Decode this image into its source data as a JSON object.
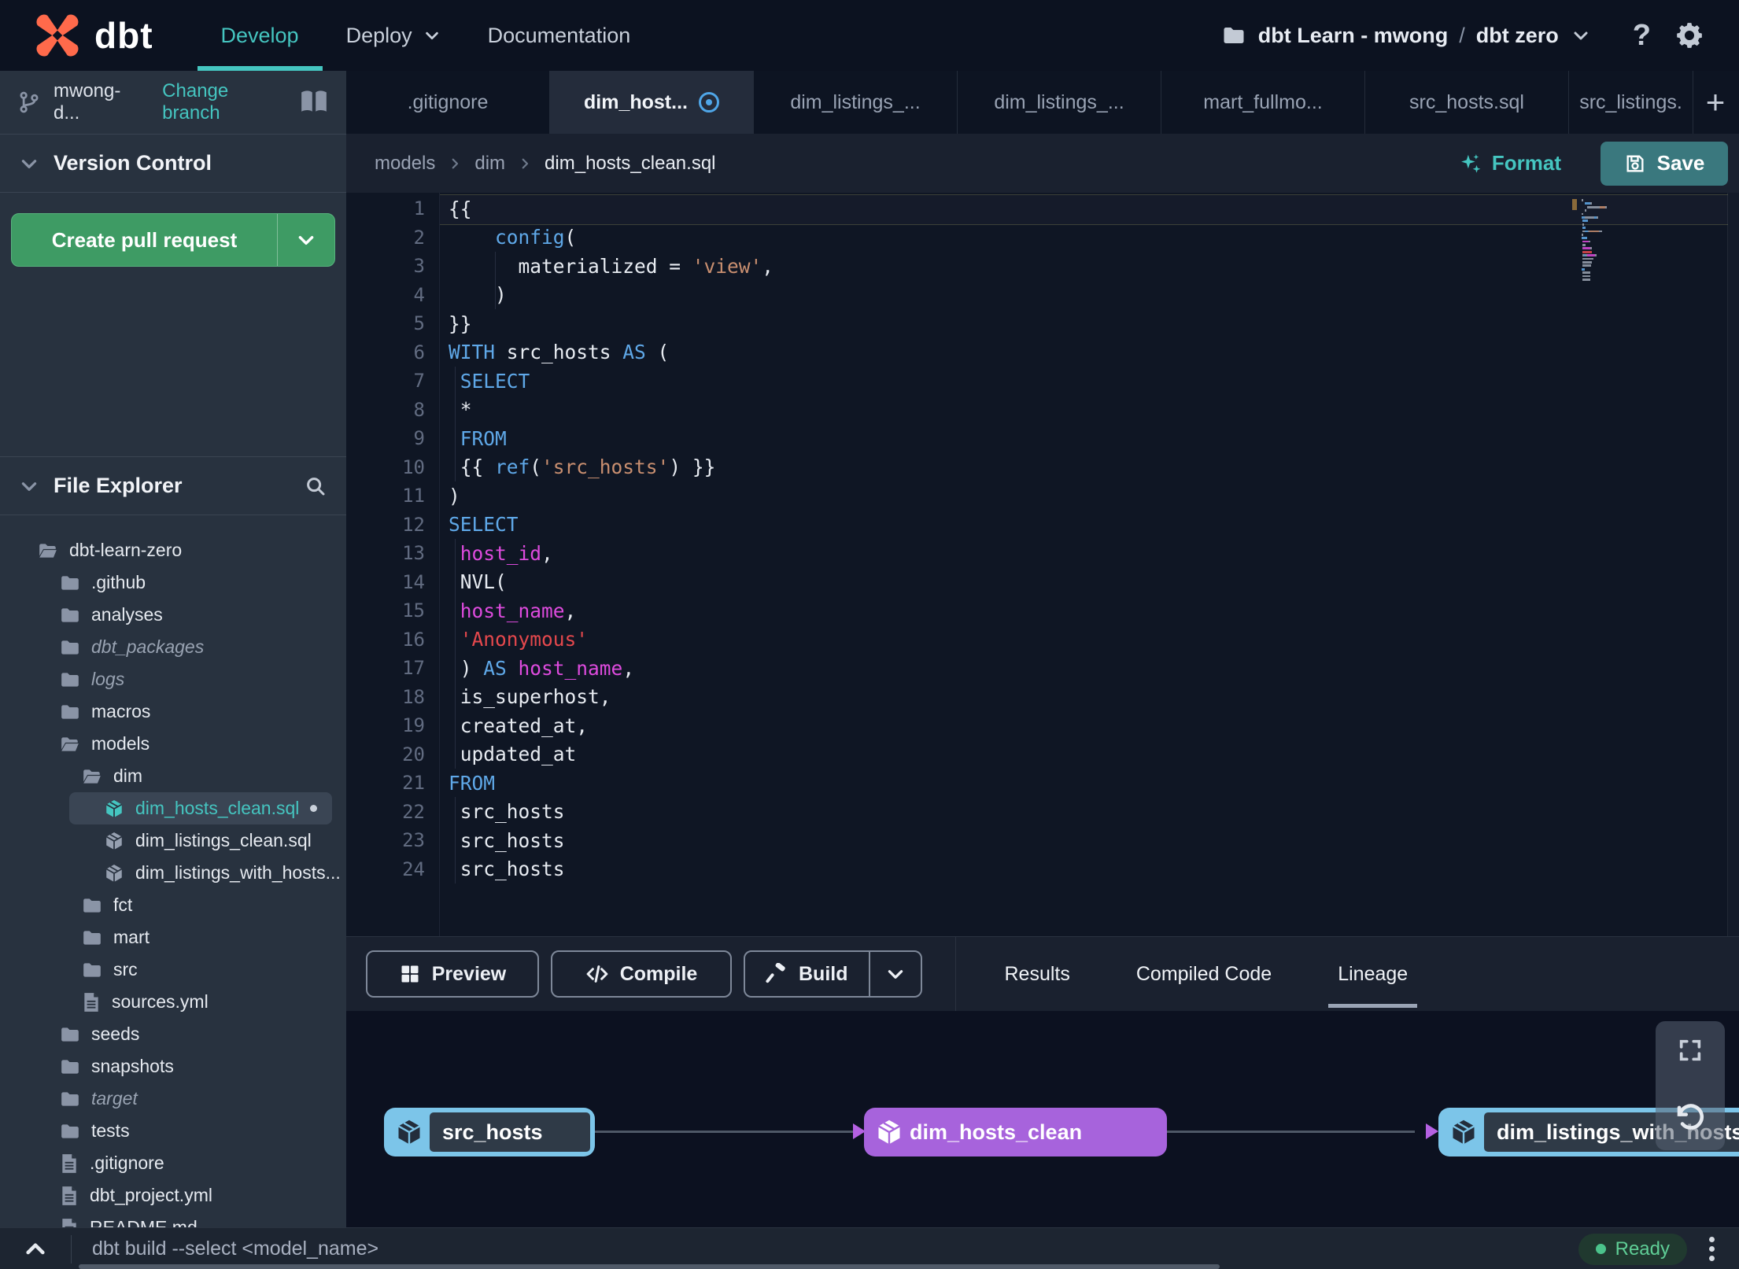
{
  "topnav": {
    "brand": "dbt",
    "nav": [
      {
        "label": "Develop",
        "active": true
      },
      {
        "label": "Deploy",
        "active": false,
        "chevron": true
      },
      {
        "label": "Documentation",
        "active": false
      }
    ],
    "project": {
      "account": "dbt Learn - mwong",
      "sep": "/",
      "name": "dbt zero"
    },
    "help_label": "?"
  },
  "sidebar": {
    "branch": {
      "name": "mwong-d...",
      "change_label": "Change branch"
    },
    "version_control": {
      "title": "Version Control",
      "button_label": "Create pull request"
    },
    "file_explorer": {
      "title": "File Explorer"
    },
    "tree": [
      {
        "label": "dbt-learn-zero",
        "type": "folder-open",
        "level": 0
      },
      {
        "label": ".github",
        "type": "folder",
        "level": 1
      },
      {
        "label": "analyses",
        "type": "folder",
        "level": 1
      },
      {
        "label": "dbt_packages",
        "type": "folder",
        "level": 1,
        "muted": true
      },
      {
        "label": "logs",
        "type": "folder",
        "level": 1,
        "muted": true
      },
      {
        "label": "macros",
        "type": "folder",
        "level": 1
      },
      {
        "label": "models",
        "type": "folder-open",
        "level": 1
      },
      {
        "label": "dim",
        "type": "folder-open",
        "level": 2
      },
      {
        "label": "dim_hosts_clean.sql",
        "type": "model",
        "level": 3,
        "selected": true,
        "modified": true
      },
      {
        "label": "dim_listings_clean.sql",
        "type": "model",
        "level": 3
      },
      {
        "label": "dim_listings_with_hosts...",
        "type": "model",
        "level": 3
      },
      {
        "label": "fct",
        "type": "folder",
        "level": 2
      },
      {
        "label": "mart",
        "type": "folder",
        "level": 2
      },
      {
        "label": "src",
        "type": "folder",
        "level": 2
      },
      {
        "label": "sources.yml",
        "type": "file",
        "level": 2
      },
      {
        "label": "seeds",
        "type": "folder",
        "level": 1
      },
      {
        "label": "snapshots",
        "type": "folder",
        "level": 1
      },
      {
        "label": "target",
        "type": "folder",
        "level": 1,
        "muted": true
      },
      {
        "label": "tests",
        "type": "folder",
        "level": 1
      },
      {
        "label": ".gitignore",
        "type": "file",
        "level": 1
      },
      {
        "label": "dbt_project.yml",
        "type": "file",
        "level": 1
      },
      {
        "label": "README.md",
        "type": "file",
        "level": 1
      }
    ]
  },
  "tabsbar": {
    "tabs": [
      {
        "label": ".gitignore",
        "active": false
      },
      {
        "label": "dim_host...",
        "active": true,
        "modified": true
      },
      {
        "label": "dim_listings_...",
        "active": false
      },
      {
        "label": "dim_listings_...",
        "active": false
      },
      {
        "label": "mart_fullmo...",
        "active": false
      },
      {
        "label": "src_hosts.sql",
        "active": false
      },
      {
        "label": "src_listings.",
        "active": false,
        "clipped": true
      }
    ],
    "add_label": "+"
  },
  "editor": {
    "breadcrumb": [
      "models",
      "dim",
      "dim_hosts_clean.sql"
    ],
    "format_label": "Format",
    "save_label": "Save",
    "palette": {
      "plain": "#E8ECF2",
      "kw": "#5FA8E8",
      "str": "#C98F70",
      "err": "#E5484D",
      "ident": "#DE4BDE"
    },
    "lines": [
      {
        "n": 1,
        "segs": [
          [
            "{{",
            "plain"
          ]
        ]
      },
      {
        "n": 2,
        "segs": [
          [
            "    ",
            "plain"
          ],
          [
            "config",
            "kw"
          ],
          [
            "(",
            "plain"
          ]
        ]
      },
      {
        "n": 3,
        "segs": [
          [
            "      materialized = ",
            "plain"
          ],
          [
            "'view'",
            "str"
          ],
          [
            ",",
            "plain"
          ]
        ]
      },
      {
        "n": 4,
        "segs": [
          [
            "    )",
            "plain"
          ]
        ]
      },
      {
        "n": 5,
        "segs": [
          [
            "}}",
            "plain"
          ]
        ]
      },
      {
        "n": 6,
        "segs": [
          [
            "WITH",
            "kw"
          ],
          [
            " src_hosts ",
            "plain"
          ],
          [
            "AS",
            "kw"
          ],
          [
            " (",
            "plain"
          ]
        ]
      },
      {
        "n": 7,
        "segs": [
          [
            " ",
            "plain"
          ],
          [
            "SELECT",
            "kw"
          ]
        ]
      },
      {
        "n": 8,
        "segs": [
          [
            " *",
            "plain"
          ]
        ]
      },
      {
        "n": 9,
        "segs": [
          [
            " ",
            "plain"
          ],
          [
            "FROM",
            "kw"
          ]
        ]
      },
      {
        "n": 10,
        "segs": [
          [
            " {{ ",
            "plain"
          ],
          [
            "ref",
            "kw"
          ],
          [
            "(",
            "plain"
          ],
          [
            "'src_hosts'",
            "str"
          ],
          [
            ") }}",
            "plain"
          ]
        ]
      },
      {
        "n": 11,
        "segs": [
          [
            ")",
            "plain"
          ]
        ]
      },
      {
        "n": 12,
        "segs": [
          [
            "SELECT",
            "kw"
          ]
        ]
      },
      {
        "n": 13,
        "segs": [
          [
            " ",
            "plain"
          ],
          [
            "host_id",
            "ident"
          ],
          [
            ",",
            "plain"
          ]
        ]
      },
      {
        "n": 14,
        "segs": [
          [
            " NVL(",
            "plain"
          ]
        ]
      },
      {
        "n": 15,
        "segs": [
          [
            " ",
            "plain"
          ],
          [
            "host_name",
            "ident"
          ],
          [
            ",",
            "plain"
          ]
        ]
      },
      {
        "n": 16,
        "segs": [
          [
            " ",
            "plain"
          ],
          [
            "'Anonymous'",
            "err"
          ]
        ]
      },
      {
        "n": 17,
        "segs": [
          [
            " ) ",
            "plain"
          ],
          [
            "AS",
            "kw"
          ],
          [
            " ",
            "plain"
          ],
          [
            "host_name",
            "ident"
          ],
          [
            ",",
            "plain"
          ]
        ]
      },
      {
        "n": 18,
        "segs": [
          [
            " is_superhost,",
            "plain"
          ]
        ]
      },
      {
        "n": 19,
        "segs": [
          [
            " created_at,",
            "plain"
          ]
        ]
      },
      {
        "n": 20,
        "segs": [
          [
            " updated_at",
            "plain"
          ]
        ]
      },
      {
        "n": 21,
        "segs": [
          [
            "FROM",
            "kw"
          ]
        ]
      },
      {
        "n": 22,
        "segs": [
          [
            " src_hosts",
            "plain"
          ]
        ]
      },
      {
        "n": 23,
        "segs": [
          [
            " src_hosts",
            "plain"
          ]
        ]
      },
      {
        "n": 24,
        "segs": [
          [
            " src_hosts",
            "plain"
          ]
        ]
      }
    ]
  },
  "toolbar": {
    "preview_label": "Preview",
    "compile_label": "Compile",
    "build_label": "Build",
    "tabs": [
      {
        "label": "Results",
        "active": false
      },
      {
        "label": "Compiled Code",
        "active": false
      },
      {
        "label": "Lineage",
        "active": true
      }
    ]
  },
  "lineage": {
    "nodes": [
      {
        "label": "src_hosts",
        "style": "source"
      },
      {
        "label": "dim_hosts_clean",
        "style": "model"
      },
      {
        "label": "dim_listings_with_hosts",
        "style": "source"
      }
    ]
  },
  "statusbar": {
    "command_placeholder": "dbt build --select <model_name>",
    "status_label": "Ready"
  },
  "colors": {
    "accent_teal": "#45C5C0",
    "green_button": "#3E9B64",
    "save_teal": "#3A787E",
    "node_blue": "#7CC5E9",
    "node_purple": "#A763DC",
    "status_green": "#4BC38B",
    "tab_modified_blue": "#4FA6E8",
    "logo_orange": "#FF6A4B"
  }
}
